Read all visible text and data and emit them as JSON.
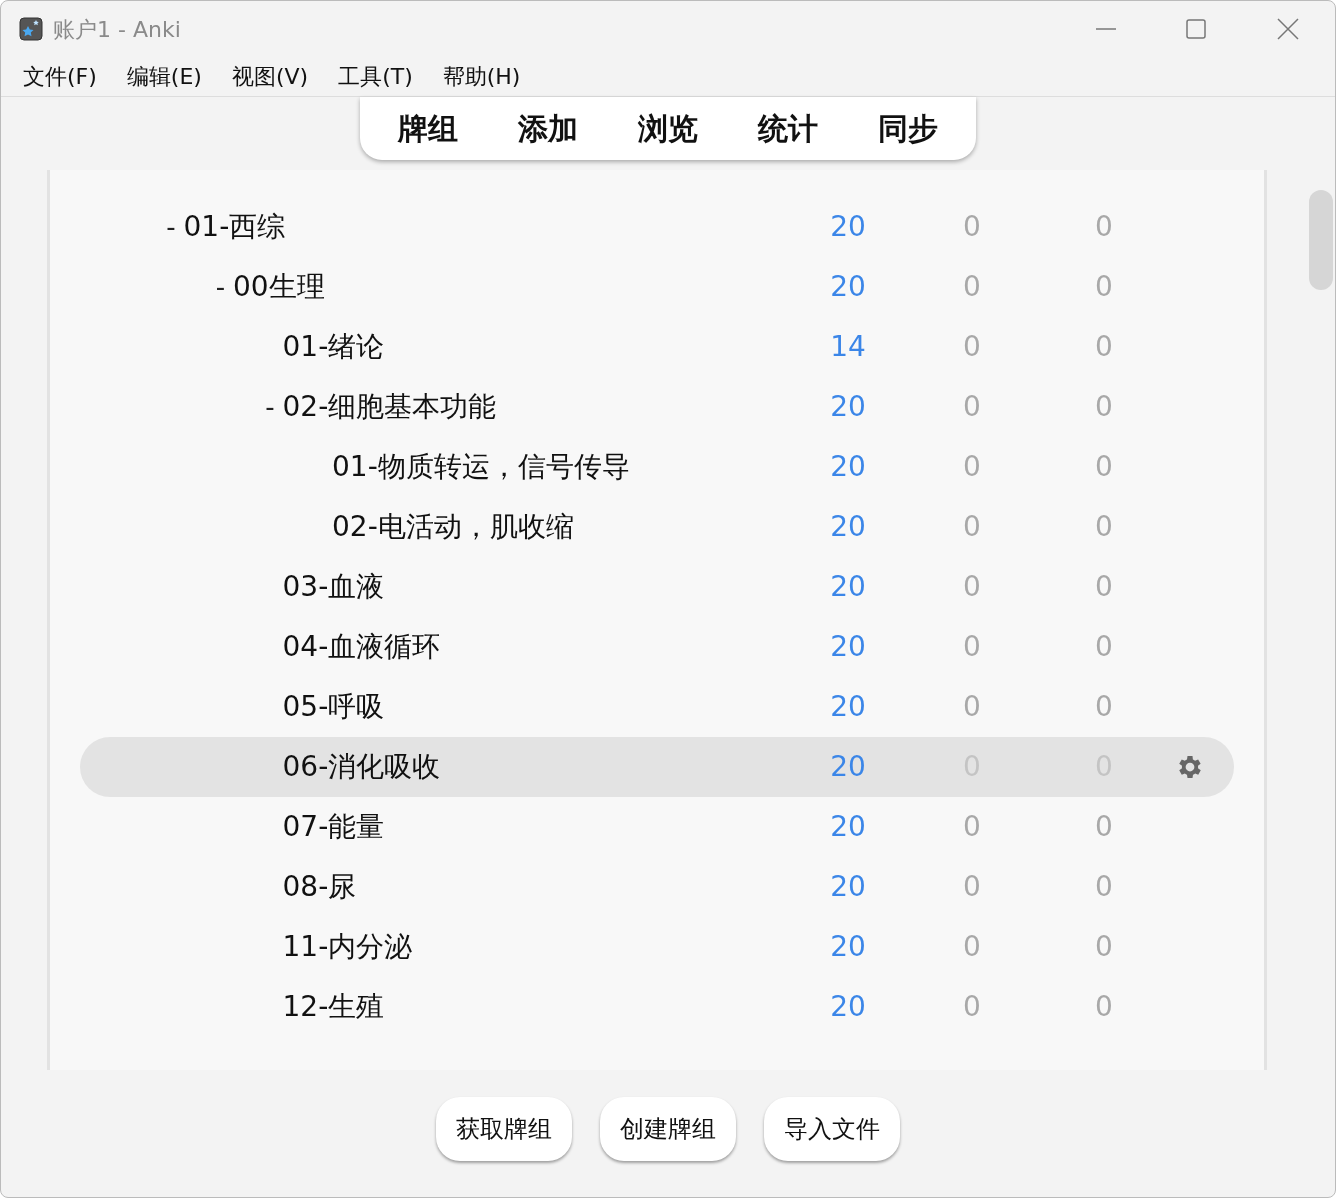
{
  "window": {
    "title": "账户1 - Anki"
  },
  "menu": [
    "文件(F)",
    "编辑(E)",
    "视图(V)",
    "工具(T)",
    "帮助(H)"
  ],
  "toolbar": [
    "牌组",
    "添加",
    "浏览",
    "统计",
    "同步"
  ],
  "decks": [
    {
      "name": "01-西综",
      "toggle": "-",
      "due": "20",
      "new": "0",
      "learn": "0",
      "selected": false,
      "children": [
        {
          "name": "00生理",
          "toggle": "-",
          "due": "20",
          "new": "0",
          "learn": "0",
          "selected": false,
          "children": [
            {
              "name": "01-绪论",
              "due": "14",
              "new": "0",
              "learn": "0",
              "selected": false
            },
            {
              "name": "02-细胞基本功能",
              "toggle": "-",
              "due": "20",
              "new": "0",
              "learn": "0",
              "selected": false,
              "children": [
                {
                  "name": "01-物质转运，信号传导",
                  "due": "20",
                  "new": "0",
                  "learn": "0",
                  "selected": false
                },
                {
                  "name": "02-电活动，肌收缩",
                  "due": "20",
                  "new": "0",
                  "learn": "0",
                  "selected": false
                }
              ]
            },
            {
              "name": "03-血液",
              "due": "20",
              "new": "0",
              "learn": "0",
              "selected": false
            },
            {
              "name": "04-血液循环",
              "due": "20",
              "new": "0",
              "learn": "0",
              "selected": false
            },
            {
              "name": "05-呼吸",
              "due": "20",
              "new": "0",
              "learn": "0",
              "selected": false
            },
            {
              "name": "06-消化吸收",
              "due": "20",
              "new": "0",
              "learn": "0",
              "selected": true
            },
            {
              "name": "07-能量",
              "due": "20",
              "new": "0",
              "learn": "0",
              "selected": false
            },
            {
              "name": "08-尿",
              "due": "20",
              "new": "0",
              "learn": "0",
              "selected": false
            },
            {
              "name": "11-内分泌",
              "due": "20",
              "new": "0",
              "learn": "0",
              "selected": false
            },
            {
              "name": "12-生殖",
              "due": "20",
              "new": "0",
              "learn": "0",
              "selected": false
            }
          ]
        }
      ]
    }
  ],
  "buttons": [
    "获取牌组",
    "创建牌组",
    "导入文件"
  ]
}
